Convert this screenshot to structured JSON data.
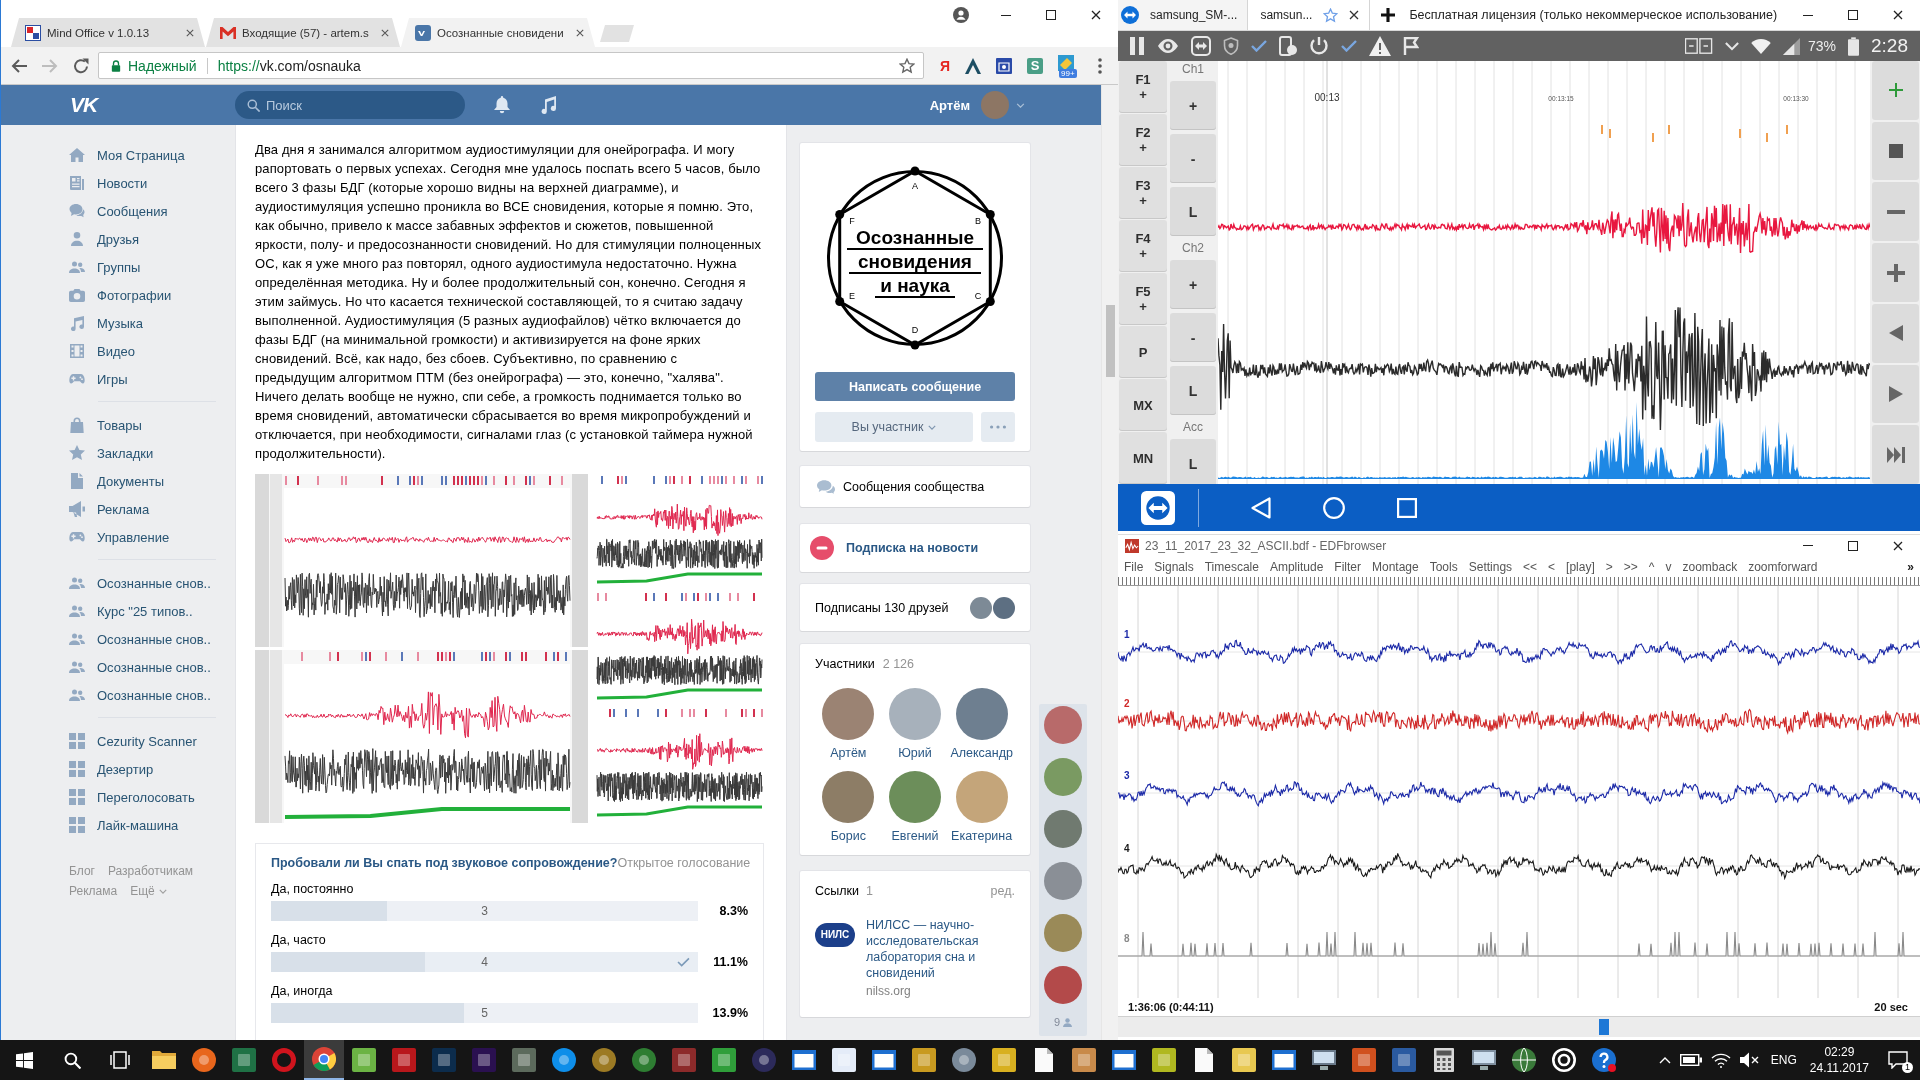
{
  "browser": {
    "tabs": [
      {
        "title": "Mind Office v 1.0.13",
        "kind": "squares",
        "selected": false
      },
      {
        "title": "Входящие (57) - artem.s",
        "kind": "mail",
        "selected": false
      },
      {
        "title": "Осознанные сновидени",
        "kind": "vk",
        "selected": true
      }
    ],
    "security_label": "Надежный",
    "url_scheme": "https://",
    "url_rest": "vk.com/osnauka",
    "extensions": [
      {
        "kind": "letter",
        "glyph": "Я",
        "color": "#e52620"
      },
      {
        "kind": "arch"
      },
      {
        "kind": "radio"
      },
      {
        "kind": "letter-tile",
        "glyph": "S",
        "color": "#4a9e86"
      },
      {
        "kind": "badge",
        "badge": "99+"
      }
    ]
  },
  "vk": {
    "logo": "VK",
    "search": {
      "placeholder": "Поиск"
    },
    "user_name": "Артём",
    "menu": [
      [
        {
          "label": "Моя Страница",
          "kind": "home"
        },
        {
          "label": "Новости",
          "kind": "news"
        },
        {
          "label": "Сообщения",
          "kind": "messages"
        },
        {
          "label": "Друзья",
          "kind": "person"
        },
        {
          "label": "Группы",
          "kind": "people"
        },
        {
          "label": "Фотографии",
          "kind": "camera"
        },
        {
          "label": "Музыка",
          "kind": "music"
        },
        {
          "label": "Видео",
          "kind": "film"
        },
        {
          "label": "Игры",
          "kind": "gamepad"
        }
      ],
      [
        {
          "label": "Товары",
          "kind": "bag"
        },
        {
          "label": "Закладки",
          "kind": "star"
        },
        {
          "label": "Документы",
          "kind": "document"
        },
        {
          "label": "Реклама",
          "kind": "megaphone"
        },
        {
          "label": "Управление",
          "kind": "gamepad"
        }
      ],
      [
        {
          "label": "Осознанные снов..",
          "kind": "people"
        },
        {
          "label": "Курс \"25 типов..",
          "kind": "people"
        },
        {
          "label": "Осознанные снов..",
          "kind": "people"
        },
        {
          "label": "Осознанные снов..",
          "kind": "people"
        },
        {
          "label": "Осознанные снов..",
          "kind": "people"
        }
      ],
      [
        {
          "label": "Cezurity Scanner",
          "kind": "apps"
        },
        {
          "label": "Дезертир",
          "kind": "apps"
        },
        {
          "label": "Переголосовать",
          "kind": "apps"
        },
        {
          "label": "Лайк-машина",
          "kind": "apps"
        }
      ]
    ],
    "footer": [
      [
        "Блог",
        "Разработчикам"
      ],
      [
        "Реклама",
        "Ещё"
      ]
    ],
    "post": {
      "text": "Два дня я занимался алгоритмом аудиостимуляции для онейрографа. И могу рапортовать о первых успехах. Сегодня мне удалось поспать всего 5 часов, было всего 3 фазы БДГ (которые хорошо видны на верхней диаграмме), и аудиостимуляция успешно проникла во ВСЕ сновидения, которые я помню. Это, как обычно, привело к массе забавных эффектов и сюжетов, повышенной яркости, полу- и предосознанности сновидений. Но для стимуляции полноценных ОС, как я уже много раз повторял, одного аудиостимула недостаточно. Нужна определённая методика. Ну и более продолжительный сон, конечно. Сегодня я этим займусь. Но что касается технической составляющей, то я считаю задачу выполненной. Аудиостимуляция (5 разных аудиофайлов) чётко включается до фазы БДГ (на минимальной громкости) и активизируется на фоне ярких сновидений. Всё, как надо, без сбоев. Субъективно, по сравнению с предыдущим алгоритмом ПТМ (без онейрографа) — это, конечно, \"халява\". Ничего делать вообще не нужно, спи себе, а громкость поднимается только во время сновидений, автоматически сбрасывается во время микропробуждений и отключается, при необходимости, сигналами глаз (с установкой таймера нужной продолжительности).",
      "poll": {
        "question": "Пробовали ли Вы спать под звуковое сопровождение?",
        "visibility": "Открытое голосование",
        "options": [
          {
            "label": "Да, постоянно",
            "count": "3",
            "percent": "8.3%",
            "level": 0.272,
            "selected": false
          },
          {
            "label": "Да, часто",
            "count": "4",
            "percent": "11.1%",
            "level": 0.36,
            "selected": true
          },
          {
            "label": "Да, иногда",
            "count": "5",
            "percent": "13.9%",
            "level": 0.452,
            "selected": false
          }
        ]
      }
    },
    "group": {
      "logo": {
        "title_lines": [
          "Осознанные",
          "сновидения",
          "и наука"
        ],
        "vertices": [
          "A",
          "B",
          "C",
          "D",
          "E",
          "F"
        ]
      },
      "message_button": "Написать сообщение",
      "member_button": "Вы участник",
      "community_messages": "Сообщения сообщества",
      "subscription": "Подписка на новости",
      "friends_subscribed": "Подписаны 130 друзей",
      "members": {
        "title": "Участники",
        "count": "2 126",
        "names": [
          "Артём",
          "Юрий",
          "Александр",
          "Борис",
          "Евгений",
          "Екатерина"
        ]
      },
      "links": {
        "title": "Ссылки",
        "count": "1",
        "edit": "ред.",
        "items": [
          {
            "logo_text": "НИЛС",
            "title": "НИЛСС — научно-исследовательская лаборатория сна и сновидений",
            "url": "nilss.org"
          }
        ]
      }
    },
    "online_friends": {
      "count": "9"
    }
  },
  "teamviewer": {
    "tabs": [
      {
        "title": "samsung_SM-...",
        "selected": false
      },
      {
        "title": "samsun...",
        "selected": true
      }
    ],
    "title": "Бесплатная лицензия (только некоммерческое использование)"
  },
  "phone": {
    "battery": "73%",
    "time": "2:28",
    "function_keys": [
      {
        "label": "F1",
        "sub": "+"
      },
      {
        "label": "F2",
        "sub": "+"
      },
      {
        "label": "F3",
        "sub": "+"
      },
      {
        "label": "F4",
        "sub": "+"
      },
      {
        "label": "F5",
        "sub": "+"
      },
      {
        "label": "P"
      },
      {
        "label": "MX"
      },
      {
        "label": "MN"
      }
    ],
    "channels": [
      {
        "name": "Ch1",
        "keys": [
          "+",
          "-",
          "L"
        ]
      },
      {
        "name": "Ch2",
        "keys": [
          "+",
          "-",
          "L"
        ]
      },
      {
        "name": "Acc",
        "keys": [
          "L"
        ]
      }
    ],
    "time_labels": [
      {
        "text": "00:13",
        "kind": "major"
      },
      {
        "text": "00:13:15",
        "kind": "minor"
      },
      {
        "text": "00:13:30",
        "kind": "minor"
      }
    ]
  },
  "edf": {
    "title": "23_11_2017_23_32_ASCII.bdf - EDFbrowser",
    "menu": [
      "File",
      "Signals",
      "Timescale",
      "Amplitude",
      "Filter",
      "Montage",
      "Tools",
      "Settings",
      "<<",
      "<",
      "[play]",
      ">",
      ">>",
      "^",
      "v",
      "zoomback",
      "zoomforward"
    ],
    "more": "»",
    "traces": [
      {
        "label": "1",
        "kind": "wave",
        "color": "#1c2aa8"
      },
      {
        "label": "2",
        "kind": "wave",
        "color": "#d02828"
      },
      {
        "label": "3",
        "kind": "wave",
        "color": "#1c2aa8"
      },
      {
        "label": "4",
        "kind": "wave",
        "color": "#1a1a1a"
      },
      {
        "label": "8",
        "kind": "pulse",
        "color": "#8a8a8a"
      }
    ],
    "position": "1:36:06 (0:44:11)",
    "span": "20 sec"
  },
  "taskbar": {
    "apps": [
      {
        "kind": "folder",
        "selected": false
      },
      {
        "kind": "disc",
        "color": "#e8661c",
        "selected": false
      },
      {
        "kind": "tile",
        "color": "#1f7145",
        "selected": false
      },
      {
        "kind": "ring",
        "color": "#d0141d",
        "selected": false
      },
      {
        "kind": "segments",
        "selected": true
      },
      {
        "kind": "tile",
        "color": "#6bb344",
        "selected": false
      },
      {
        "kind": "tile",
        "color": "#b8171b",
        "selected": false
      },
      {
        "kind": "tile",
        "color": "#0c2c4c",
        "selected": false
      },
      {
        "kind": "tile",
        "color": "#2a1050",
        "selected": false
      },
      {
        "kind": "tile",
        "color": "#5c6a5c",
        "selected": false
      },
      {
        "kind": "disc",
        "color": "#0e8ee9",
        "selected": false
      },
      {
        "kind": "disc",
        "color": "#9c7a24",
        "selected": false
      },
      {
        "kind": "disc",
        "color": "#2e7d32",
        "selected": false
      },
      {
        "kind": "tile",
        "color": "#8c2a2a",
        "selected": false
      },
      {
        "kind": "tile",
        "color": "#2f9e3a",
        "selected": false
      },
      {
        "kind": "disc",
        "color": "#2c2a5a",
        "selected": false
      },
      {
        "kind": "window",
        "color": "#1e6fd0",
        "selected": false
      },
      {
        "kind": "tile",
        "color": "#e4ecf8",
        "selected": false
      },
      {
        "kind": "window",
        "color": "#1e6fd0",
        "selected": false
      },
      {
        "kind": "tile",
        "color": "#c89a20",
        "selected": false
      },
      {
        "kind": "disc",
        "color": "#7a8a9a",
        "selected": false
      },
      {
        "kind": "tile",
        "color": "#d8b020",
        "selected": false
      },
      {
        "kind": "doc",
        "selected": false
      },
      {
        "kind": "tile",
        "color": "#c88a4a",
        "selected": false
      },
      {
        "kind": "window",
        "color": "#1e6fd0",
        "selected": false
      },
      {
        "kind": "tile",
        "color": "#b0b820",
        "selected": false
      },
      {
        "kind": "doc",
        "selected": false
      },
      {
        "kind": "tile",
        "color": "#e8c850",
        "selected": false
      },
      {
        "kind": "window",
        "color": "#1e6fd0",
        "selected": false
      },
      {
        "kind": "monitor",
        "color": "#6a7a8a",
        "selected": false
      },
      {
        "kind": "tile",
        "color": "#d0501e",
        "selected": false
      },
      {
        "kind": "tile",
        "color": "#2a5aa0",
        "selected": false
      },
      {
        "kind": "calc",
        "selected": false
      },
      {
        "kind": "monitor",
        "color": "#8090a0",
        "selected": false
      },
      {
        "kind": "globe",
        "color": "#3a7a3a",
        "selected": false
      },
      {
        "kind": "target",
        "selected": false
      },
      {
        "kind": "help",
        "color": "#1a6fd0",
        "selected": false
      }
    ],
    "language": "ENG",
    "time": "02:29",
    "date": "24.11.2017",
    "notifications": "1"
  }
}
